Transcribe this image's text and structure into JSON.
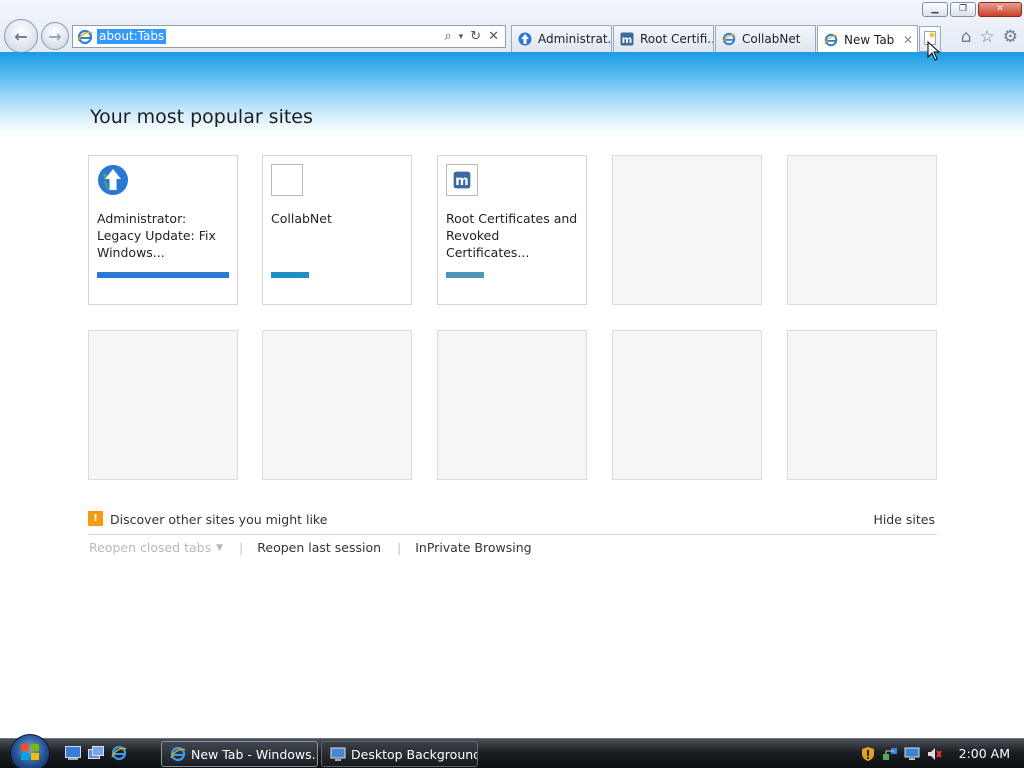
{
  "window": {
    "controls": {
      "minimize_icon": "minimize-icon",
      "restore_icon": "restore-icon",
      "close_icon": "close-icon"
    }
  },
  "toolbar": {
    "back_icon": "back-arrow-icon",
    "forward_icon": "forward-arrow-icon",
    "address": {
      "value": "about:Tabs",
      "icon": "ie-icon"
    },
    "address_tools": [
      "search-icon",
      "dropdown-icon",
      "refresh-icon",
      "stop-icon"
    ],
    "right_tools": [
      "home-icon",
      "favorites-star-icon",
      "tools-gear-icon"
    ]
  },
  "tabs": [
    {
      "label": "Administrat...",
      "icon": "update-globe-icon"
    },
    {
      "label": "Root Certifi...",
      "icon": "site-m-icon"
    },
    {
      "label": "CollabNet",
      "icon": "ie-icon"
    },
    {
      "label": "New Tab",
      "icon": "ie-icon",
      "active": true,
      "close": "✕"
    }
  ],
  "newtab": {
    "icon": "new-tab-icon"
  },
  "page": {
    "heading": "Your most popular sites",
    "tiles": [
      {
        "name": "Administrator: Legacy Update: Fix Windows...",
        "icon": "update-globe-icon",
        "activity": 1.0,
        "bar_color": "#2a7bd6"
      },
      {
        "name": "CollabNet",
        "icon": "blank-page-icon",
        "activity": 0.29,
        "bar_color": "#1f8fc5"
      },
      {
        "name": "Root Certificates and Revoked Certificates...",
        "icon": "site-m-icon",
        "activity": 0.29,
        "bar_color": "#4f93bd"
      },
      {
        "name": "",
        "empty": true
      },
      {
        "name": "",
        "empty": true
      },
      {
        "name": "",
        "empty": true
      },
      {
        "name": "",
        "empty": true
      },
      {
        "name": "",
        "empty": true
      },
      {
        "name": "",
        "empty": true
      },
      {
        "name": "",
        "empty": true
      }
    ],
    "discover": {
      "text": "Discover other sites you might like",
      "hide": "Hide sites",
      "icon": "lightbulb-icon"
    },
    "links": {
      "reopen_closed": "Reopen closed tabs",
      "reopen_last": "Reopen last session",
      "inprivate": "InPrivate Browsing",
      "separator": "|"
    }
  },
  "taskbar": {
    "start_icon": "windows-start-orb-icon",
    "quicklaunch": [
      "show-desktop-icon",
      "switch-windows-icon",
      "ie-icon"
    ],
    "tasks": [
      {
        "label": "New Tab - Windows...",
        "icon": "ie-icon",
        "active": true
      },
      {
        "label": "Desktop Background",
        "icon": "display-icon",
        "active": false
      }
    ],
    "tray": [
      "security-shield-icon",
      "network-icon",
      "monitor-icon",
      "speaker-muted-icon"
    ],
    "clock": "2:00 AM"
  }
}
